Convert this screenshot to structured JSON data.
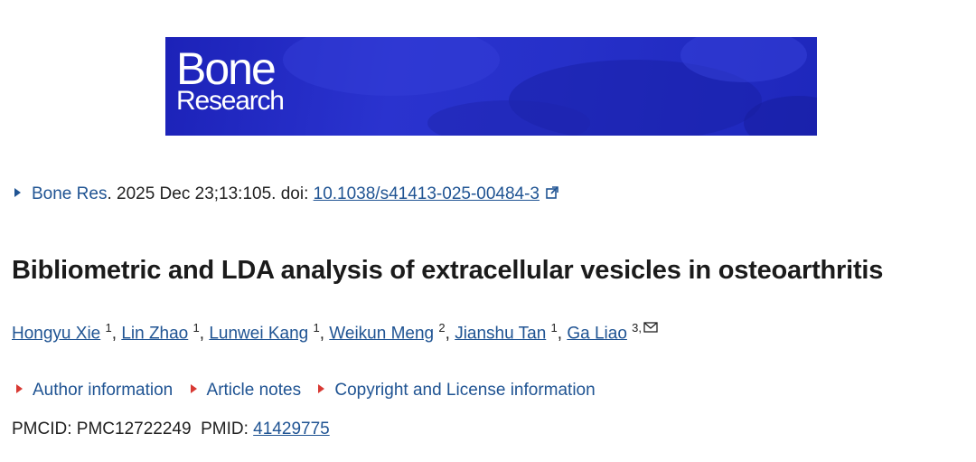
{
  "banner": {
    "logo_line1": "Bone",
    "logo_line2": "Research",
    "background_color": "#2630c9"
  },
  "citation": {
    "journal": "Bone Res",
    "details": ". 2025 Dec 23;13:105. doi: ",
    "doi": "10.1038/s41413-025-00484-3",
    "link_color": "#205493"
  },
  "article": {
    "title": "Bibliometric and LDA analysis of extracellular vesicles in osteoarthritis"
  },
  "authors": [
    {
      "name": "Hongyu Xie",
      "aff": "1"
    },
    {
      "name": "Lin Zhao",
      "aff": "1"
    },
    {
      "name": "Lunwei Kang",
      "aff": "1"
    },
    {
      "name": "Weikun Meng",
      "aff": "2"
    },
    {
      "name": "Jianshu Tan",
      "aff": "1"
    },
    {
      "name": "Ga Liao",
      "aff": "3,"
    }
  ],
  "disclosures": [
    {
      "label": "Author information"
    },
    {
      "label": "Article notes"
    },
    {
      "label": "Copyright and License information"
    }
  ],
  "ids": {
    "pmcid_label": "PMCID: PMC12722249",
    "pmid_label": "PMID: ",
    "pmid": "41429775"
  }
}
